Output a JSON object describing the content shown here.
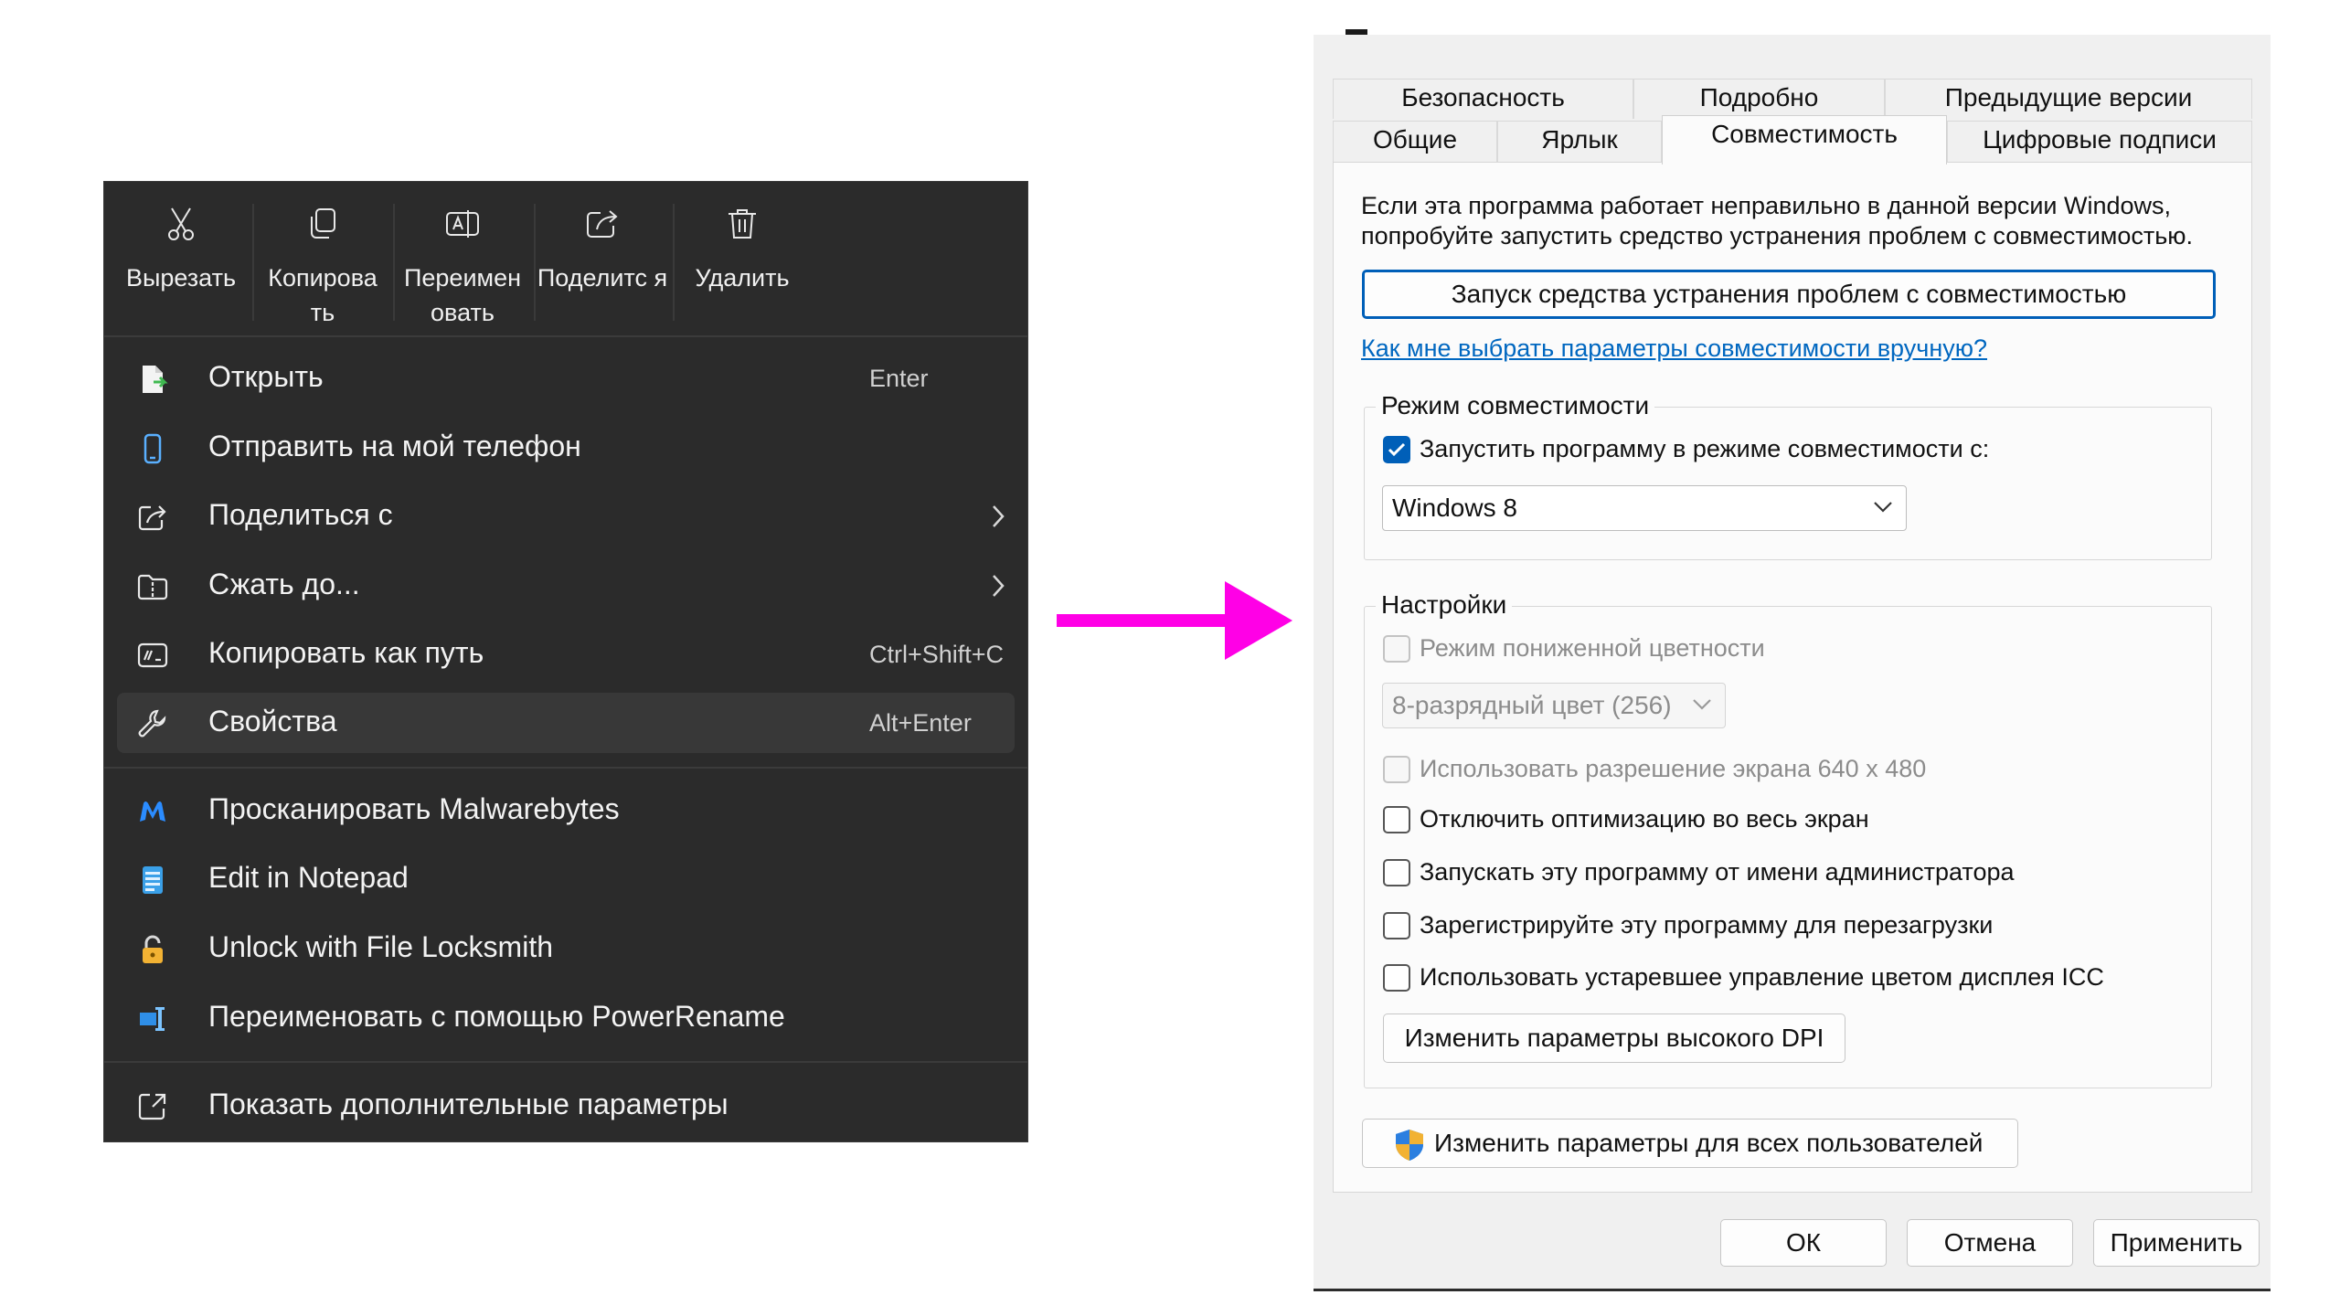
{
  "context_menu": {
    "toolbar": [
      {
        "icon": "scissors-icon",
        "label": "Вырезать"
      },
      {
        "icon": "copy-icon",
        "label_line1": "Копирова",
        "label_line2": "ть"
      },
      {
        "icon": "rename-icon",
        "label_line1": "Переимен",
        "label_line2": "овать"
      },
      {
        "icon": "share-icon",
        "label_line1": "Поделитс",
        "label_line2": "я"
      },
      {
        "icon": "trash-icon",
        "label": "Удалить"
      }
    ],
    "items": [
      {
        "icon": "open-file-icon",
        "label": "Открыть",
        "shortcut": "Enter"
      },
      {
        "icon": "phone-icon",
        "label": "Отправить на мой телефон"
      },
      {
        "icon": "share-icon",
        "label": "Поделиться с",
        "submenu": true
      },
      {
        "icon": "zip-folder-icon",
        "label": "Сжать до...",
        "submenu": true
      },
      {
        "icon": "copy-path-icon",
        "label": "Копировать как путь",
        "shortcut": "Ctrl+Shift+C"
      },
      {
        "icon": "wrench-icon",
        "label": "Свойства",
        "shortcut": "Alt+Enter",
        "selected": true
      },
      {
        "icon": "malwarebytes-icon",
        "label": "Просканировать Malwarebytes"
      },
      {
        "icon": "notepad-icon",
        "label": "Edit in Notepad"
      },
      {
        "icon": "lock-icon",
        "label": "Unlock with File Locksmith"
      },
      {
        "icon": "powerrename-icon",
        "label": "Переименовать с помощью PowerRename"
      },
      {
        "icon": "more-options-icon",
        "label": "Показать дополнительные параметры"
      }
    ]
  },
  "arrow_color": "#ff00e6",
  "dialog": {
    "tabs_row1": [
      "Безопасность",
      "Подробно",
      "Предыдущие версии"
    ],
    "tabs_row2": [
      "Общие",
      "Ярлык",
      "Совместимость",
      "Цифровые подписи"
    ],
    "active_tab": "Совместимость",
    "intro_line1": "Если эта программа работает неправильно в данной версии Windows,",
    "intro_line2": "попробуйте запустить средство устранения проблем с совместимостью.",
    "troubleshoot_button": "Запуск средства устранения проблем с совместимостью",
    "manual_link": "Как мне выбрать параметры совместимости вручную?",
    "compat_group": {
      "title": "Режим совместимости",
      "checkbox_label": "Запустить программу в режиме совместимости с:",
      "checked": true,
      "os_value": "Windows 8"
    },
    "settings_group": {
      "title": "Настройки",
      "reduced_color": {
        "label": "Режим пониженной цветности",
        "checked": false,
        "disabled": true
      },
      "color_select": "8-разрядный цвет (256)",
      "res_640": {
        "label": "Использовать разрешение экрана 640 x 480",
        "checked": false,
        "disabled": true
      },
      "disable_fullscreen": {
        "label": "Отключить оптимизацию во весь экран",
        "checked": false
      },
      "run_as_admin": {
        "label": "Запускать эту программу от имени администратора",
        "checked": false
      },
      "register_restart": {
        "label": "Зарегистрируйте эту программу для перезагрузки",
        "checked": false
      },
      "legacy_icc": {
        "label": "Использовать устаревшее управление цветом дисплея ICC",
        "checked": false
      },
      "high_dpi_button": "Изменить параметры высокого DPI"
    },
    "all_users_button": "Изменить параметры для всех пользователей",
    "footer": {
      "ok": "ОК",
      "cancel": "Отмена",
      "apply": "Применить"
    },
    "colors": {
      "accent": "#005fb8",
      "link": "#0067c0",
      "panel": "#fbfbfb",
      "chrome": "#f0f0f0"
    }
  }
}
